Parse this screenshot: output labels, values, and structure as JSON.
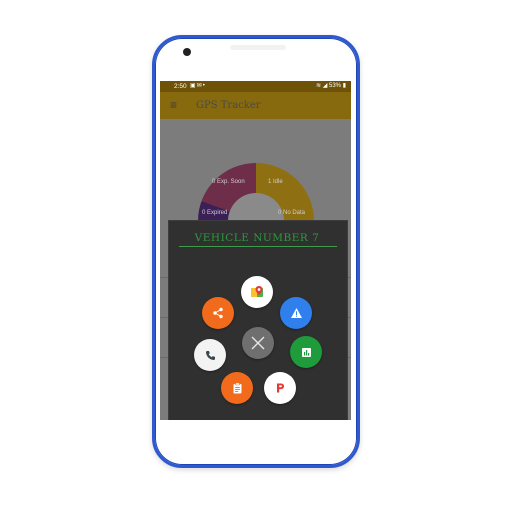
{
  "status_bar": {
    "time": "2:50",
    "battery": "53%"
  },
  "app_bar": {
    "title": "GPS Tracker"
  },
  "dashboard": {
    "segments": [
      {
        "label": "0 Exp. Soon"
      },
      {
        "label": "1 Idle"
      },
      {
        "label": "0 Expired"
      },
      {
        "label": "0 No Data"
      }
    ]
  },
  "dialog": {
    "title": "VEHICLE NUMBER 7"
  },
  "actions": [
    {
      "icon": "map-pin-icon",
      "color": "#ffffff"
    },
    {
      "icon": "share-icon",
      "color": "#f26a1b"
    },
    {
      "icon": "warning-icon",
      "color": "#2f80ed"
    },
    {
      "icon": "close-icon",
      "color": "#6f6f6f"
    },
    {
      "icon": "phone-icon",
      "color": "#f3f3f3"
    },
    {
      "icon": "report-icon",
      "color": "#1e9b3a"
    },
    {
      "icon": "clipboard-icon",
      "color": "#f26a1b"
    },
    {
      "icon": "parking-icon",
      "color": "#ffffff"
    }
  ]
}
